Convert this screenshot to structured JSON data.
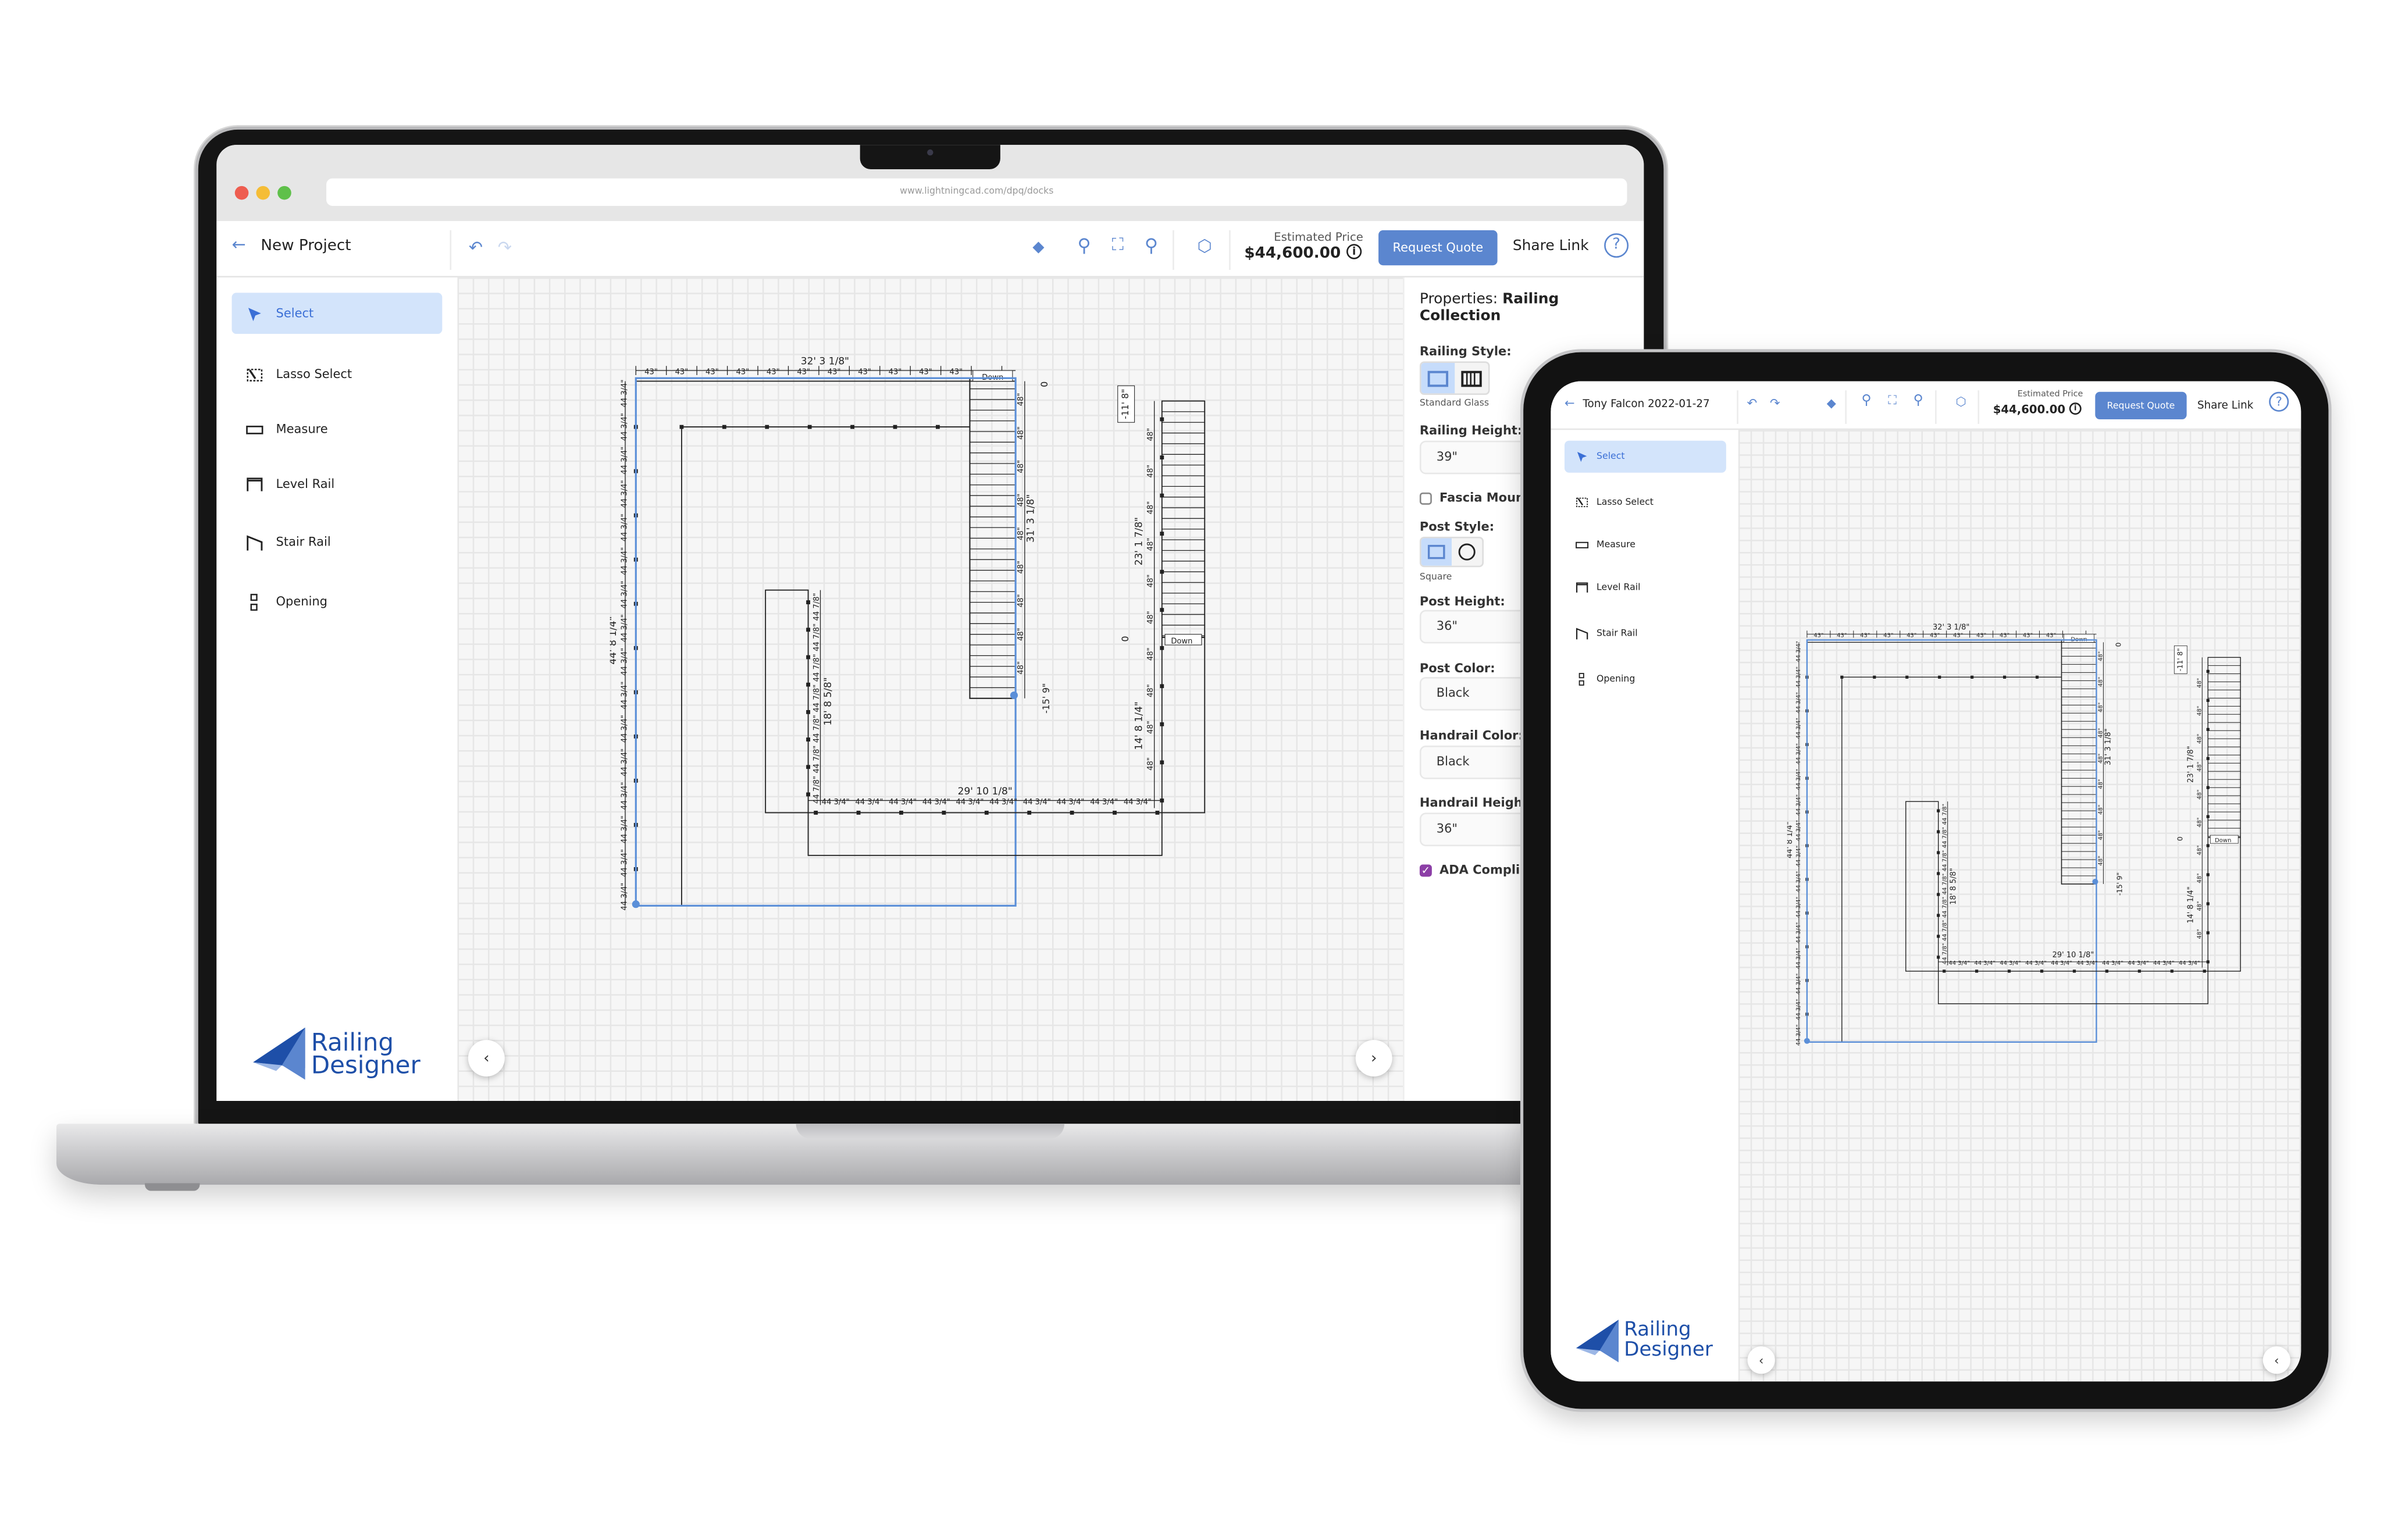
{
  "browser": {
    "url": "www.lightningcad.com/dpq/docks"
  },
  "colors": {
    "accent": "#5b86cf",
    "selected_bg": "#d3e4fb",
    "checkbox": "#8c3fa6",
    "selection_outline": "#5b8fd8"
  },
  "laptop": {
    "header": {
      "back_icon": "arrow-left-icon",
      "project_title": "New Project",
      "estimated_price_label": "Estimated Price",
      "estimated_price": "$44,600.00",
      "request_quote": "Request Quote",
      "share_link": "Share Link"
    },
    "properties": {
      "title_prefix": "Properties:",
      "title_bold": "Railing Collection",
      "railing_style_label": "Railing Style:",
      "railing_style_value": "Standard Glass",
      "railing_height_label": "Railing Height:",
      "railing_height": "39\"",
      "fascia_mount_label": "Fascia Mount",
      "fascia_mount_checked": false,
      "post_style_label": "Post Style:",
      "post_style_value": "Square",
      "post_height_label": "Post Height:",
      "post_height": "36\"",
      "post_color_label": "Post Color:",
      "post_color": "Black",
      "handrail_color_label": "Handrail Color:",
      "handrail_color": "Black",
      "handrail_height_label": "Handrail Height:",
      "handrail_height": "36\"",
      "ada_label": "ADA Compliant",
      "ada_checked": true
    }
  },
  "tablet": {
    "header": {
      "project_title": "Tony Falcon 2022-01-27",
      "estimated_price_label": "Estimated Price",
      "estimated_price": "$44,600.00",
      "request_quote": "Request Quote",
      "share_link": "Share Link"
    }
  },
  "sidebar": {
    "items": [
      {
        "label": "Select",
        "icon": "cursor-arrow-icon",
        "selected": true
      },
      {
        "label": "Lasso Select",
        "icon": "lasso-icon"
      },
      {
        "label": "Measure",
        "icon": "ruler-icon"
      },
      {
        "label": "Level Rail",
        "icon": "level-rail-icon"
      },
      {
        "label": "Stair Rail",
        "icon": "stair-rail-icon"
      },
      {
        "label": "Opening",
        "icon": "opening-icon"
      }
    ]
  },
  "logo": {
    "line1": "Railing",
    "line2": "Designer"
  },
  "drawing": {
    "top_dim": "32' 3 1/8\"",
    "top_seg": "43\"",
    "left_dim": "44' 8 1/4\"",
    "left_seg": "44 3/4\"",
    "inner_left_dim": "18' 8 5/8\"",
    "inner_seg": "44 7/8\"",
    "bottom_dim": "29' 10 1/8\"",
    "bottom_seg": "44 3/4\"",
    "stair1_dim": "31' 3 1/8\"",
    "stair1_elev": "-15' 9\"",
    "stair1_zero": "0",
    "stair2_dim": "23' 1 7/8\"",
    "stair2_lower_dim": "14' 8 1/4\"",
    "stair2_elev": "-11' 8\"",
    "stair2_zero": "0",
    "stair_seg": "48\"",
    "down_label": "Down"
  }
}
